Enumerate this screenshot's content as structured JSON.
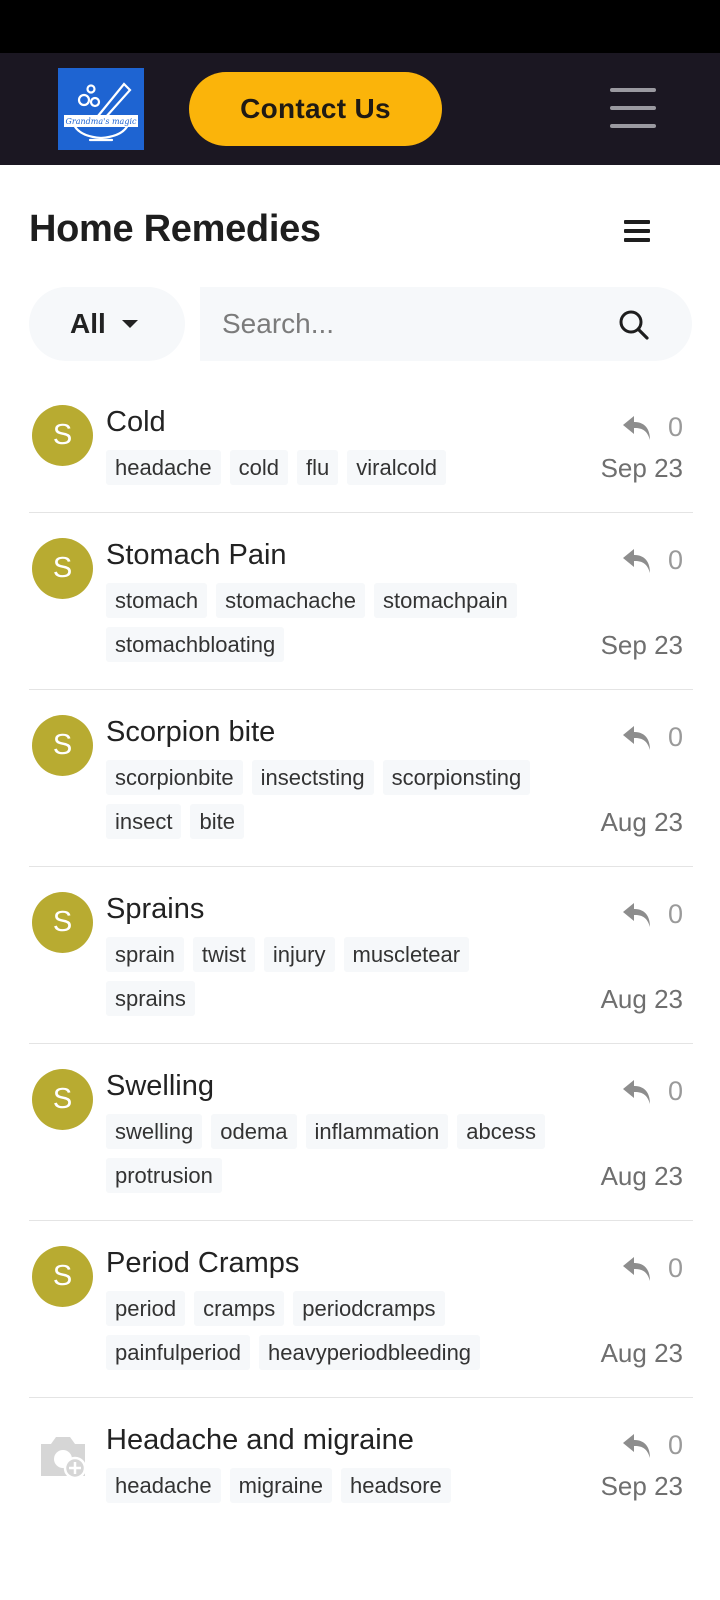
{
  "navbar": {
    "logo_text": "Grandma's magic",
    "contact_label": "Contact Us",
    "brand_color": "#fbb40a",
    "background": "#1b1722"
  },
  "page": {
    "title": "Home Remedies"
  },
  "filter": {
    "selected": "All"
  },
  "search": {
    "placeholder": "Search..."
  },
  "avatar_color": "#b8ab31",
  "topics": [
    {
      "avatar": "S",
      "title": "Cold",
      "tags": [
        "headache",
        "cold",
        "flu",
        "viralcold"
      ],
      "replies": "0",
      "date": "Sep 23"
    },
    {
      "avatar": "S",
      "title": "Stomach Pain",
      "tags": [
        "stomach",
        "stomachache",
        "stomachpain",
        "stomachbloating"
      ],
      "replies": "0",
      "date": "Sep 23"
    },
    {
      "avatar": "S",
      "title": "Scorpion bite",
      "tags": [
        "scorpionbite",
        "insectsting",
        "scorpionsting",
        "insect",
        "bite"
      ],
      "replies": "0",
      "date": "Aug 23"
    },
    {
      "avatar": "S",
      "title": "Sprains",
      "tags": [
        "sprain",
        "twist",
        "injury",
        "muscletear",
        "sprains"
      ],
      "replies": "0",
      "date": "Aug 23"
    },
    {
      "avatar": "S",
      "title": "Swelling",
      "tags": [
        "swelling",
        "odema",
        "inflammation",
        "abcess",
        "protrusion"
      ],
      "replies": "0",
      "date": "Aug 23"
    },
    {
      "avatar": "S",
      "title": "Period Cramps",
      "tags": [
        "period",
        "cramps",
        "periodcramps",
        "painfulperiod",
        "heavyperiodbleeding"
      ],
      "replies": "0",
      "date": "Aug 23"
    },
    {
      "avatar": "",
      "title": "Headache and migraine",
      "tags": [
        "headache",
        "migraine",
        "headsore"
      ],
      "replies": "0",
      "date": "Sep 23"
    }
  ]
}
